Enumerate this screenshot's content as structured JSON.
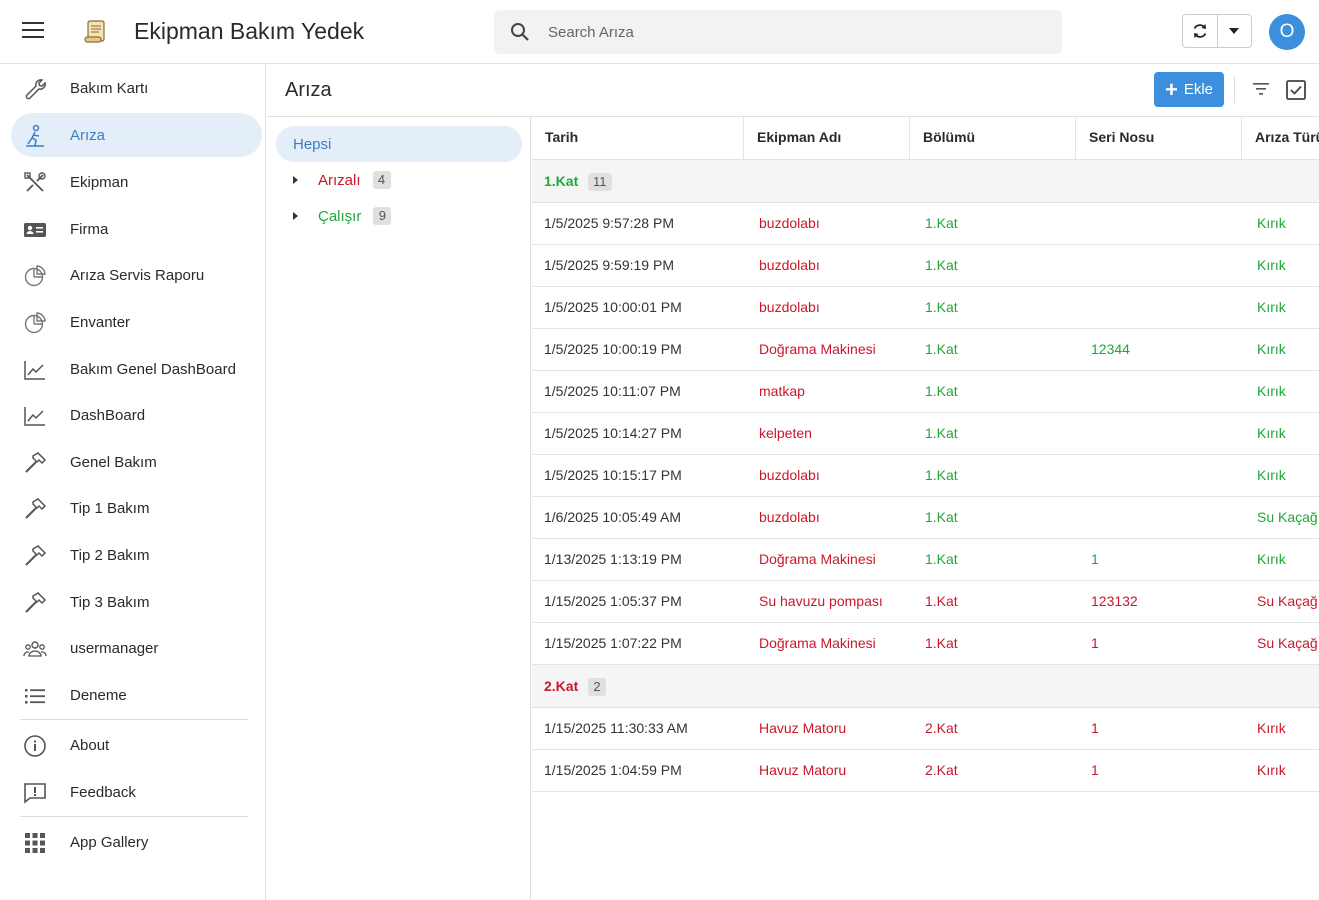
{
  "app": {
    "title": "Ekipman Bakım Yedek",
    "avatar_letter": "O"
  },
  "search": {
    "placeholder": "Search Arıza",
    "value": ""
  },
  "colors": {
    "accent": "#3b8fdc",
    "red": "#c9182b",
    "green": "#22a63b"
  },
  "sidebar": {
    "items": [
      {
        "label": "Bakım Kartı",
        "icon": "wrench-icon"
      },
      {
        "label": "Arıza",
        "icon": "person-repair-icon",
        "active": true
      },
      {
        "label": "Ekipman",
        "icon": "tools-icon"
      },
      {
        "label": "Firma",
        "icon": "id-card-icon"
      },
      {
        "label": "Arıza Servis Raporu",
        "icon": "pie-chart-icon"
      },
      {
        "label": "Envanter",
        "icon": "pie-chart-icon"
      },
      {
        "label": "Bakım Genel DashBoard",
        "icon": "trend-chart-icon"
      },
      {
        "label": "DashBoard",
        "icon": "trend-chart-icon"
      },
      {
        "label": "Genel Bakım",
        "icon": "hammer-icon"
      },
      {
        "label": "Tip 1 Bakım",
        "icon": "hammer-icon"
      },
      {
        "label": "Tip 2 Bakım",
        "icon": "hammer-icon"
      },
      {
        "label": "Tip 3 Bakım",
        "icon": "hammer-icon"
      },
      {
        "label": "usermanager",
        "icon": "users-icon"
      },
      {
        "label": "Deneme",
        "icon": "list-icon"
      }
    ],
    "secondary": [
      {
        "label": "About",
        "icon": "info-icon"
      },
      {
        "label": "Feedback",
        "icon": "feedback-icon"
      }
    ],
    "gallery": {
      "label": "App Gallery",
      "icon": "grid-icon"
    }
  },
  "content": {
    "title": "Arıza",
    "add_label": "Ekle"
  },
  "tree": {
    "all": "Hepsi",
    "nodes": [
      {
        "label": "Arızalı",
        "count": "4",
        "color": "red"
      },
      {
        "label": "Çalışır",
        "count": "9",
        "color": "green"
      }
    ]
  },
  "grid": {
    "columns": [
      "Tarih",
      "Ekipman Adı",
      "Bölümü",
      "Seri Nosu",
      "Arıza Türü"
    ],
    "groups": [
      {
        "label": "1.Kat",
        "count": "11",
        "color": "green",
        "rows": [
          {
            "tarih": "1/5/2025 9:57:28 PM",
            "ekipman": "buzdolabı",
            "bolum": "1.Kat",
            "seri": "",
            "tur": "Kırık",
            "ekipman_color": "red",
            "bolum_color": "green",
            "seri_color": "green",
            "tur_color": "green"
          },
          {
            "tarih": "1/5/2025 9:59:19 PM",
            "ekipman": "buzdolabı",
            "bolum": "1.Kat",
            "seri": "",
            "tur": "Kırık",
            "ekipman_color": "red",
            "bolum_color": "green",
            "seri_color": "green",
            "tur_color": "green"
          },
          {
            "tarih": "1/5/2025 10:00:01 PM",
            "ekipman": "buzdolabı",
            "bolum": "1.Kat",
            "seri": "",
            "tur": "Kırık",
            "ekipman_color": "red",
            "bolum_color": "green",
            "seri_color": "green",
            "tur_color": "green"
          },
          {
            "tarih": "1/5/2025 10:00:19 PM",
            "ekipman": "Doğrama Makinesi",
            "bolum": "1.Kat",
            "seri": "12344",
            "tur": "Kırık",
            "ekipman_color": "red",
            "bolum_color": "green",
            "seri_color": "green",
            "tur_color": "green"
          },
          {
            "tarih": "1/5/2025 10:11:07 PM",
            "ekipman": "matkap",
            "bolum": "1.Kat",
            "seri": "",
            "tur": "Kırık",
            "ekipman_color": "red",
            "bolum_color": "green",
            "seri_color": "green",
            "tur_color": "green"
          },
          {
            "tarih": "1/5/2025 10:14:27 PM",
            "ekipman": "kelpeten",
            "bolum": "1.Kat",
            "seri": "",
            "tur": "Kırık",
            "ekipman_color": "red",
            "bolum_color": "green",
            "seri_color": "green",
            "tur_color": "green"
          },
          {
            "tarih": "1/5/2025 10:15:17 PM",
            "ekipman": "buzdolabı",
            "bolum": "1.Kat",
            "seri": "",
            "tur": "Kırık",
            "ekipman_color": "red",
            "bolum_color": "green",
            "seri_color": "green",
            "tur_color": "green"
          },
          {
            "tarih": "1/6/2025 10:05:49 AM",
            "ekipman": "buzdolabı",
            "bolum": "1.Kat",
            "seri": "",
            "tur": "Su Kaçağı",
            "ekipman_color": "red",
            "bolum_color": "green",
            "seri_color": "green",
            "tur_color": "green"
          },
          {
            "tarih": "1/13/2025 1:13:19 PM",
            "ekipman": "Doğrama Makinesi",
            "bolum": "1.Kat",
            "seri": "1",
            "tur": "Kırık",
            "ekipman_color": "red",
            "bolum_color": "green",
            "seri_color": "green",
            "tur_color": "green"
          },
          {
            "tarih": "1/15/2025 1:05:37 PM",
            "ekipman": "Su havuzu pompası",
            "bolum": "1.Kat",
            "seri": "123132",
            "tur": "Su Kaçağı",
            "ekipman_color": "red",
            "bolum_color": "red",
            "seri_color": "red",
            "tur_color": "red"
          },
          {
            "tarih": "1/15/2025 1:07:22 PM",
            "ekipman": "Doğrama Makinesi",
            "bolum": "1.Kat",
            "seri": "1",
            "tur": "Su Kaçağı",
            "ekipman_color": "red",
            "bolum_color": "red",
            "seri_color": "red",
            "tur_color": "red"
          }
        ]
      },
      {
        "label": "2.Kat",
        "count": "2",
        "color": "red",
        "rows": [
          {
            "tarih": "1/15/2025 11:30:33 AM",
            "ekipman": "Havuz Matoru",
            "bolum": "2.Kat",
            "seri": "1",
            "tur": "Kırık",
            "ekipman_color": "red",
            "bolum_color": "red",
            "seri_color": "red",
            "tur_color": "red"
          },
          {
            "tarih": "1/15/2025 1:04:59 PM",
            "ekipman": "Havuz Matoru",
            "bolum": "2.Kat",
            "seri": "1",
            "tur": "Kırık",
            "ekipman_color": "red",
            "bolum_color": "red",
            "seri_color": "red",
            "tur_color": "red"
          }
        ]
      }
    ]
  }
}
